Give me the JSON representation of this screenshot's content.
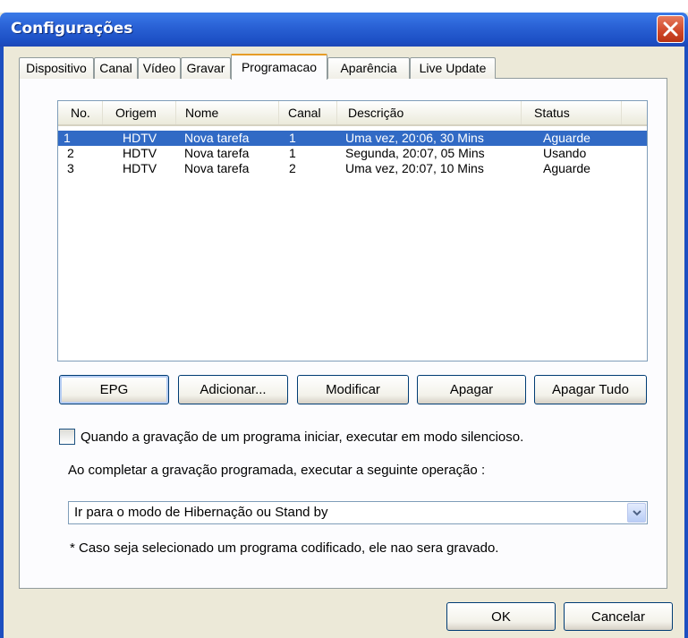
{
  "window": {
    "title": "Configurações"
  },
  "tabs": [
    {
      "label": "Dispositivo"
    },
    {
      "label": "Canal"
    },
    {
      "label": "Vídeo"
    },
    {
      "label": "Gravar"
    },
    {
      "label": "Programacao"
    },
    {
      "label": "Aparência"
    },
    {
      "label": "Live Update"
    }
  ],
  "active_tab": "Programacao",
  "schedule_list": {
    "columns": [
      "No.",
      "Origem",
      "Nome",
      "Canal",
      "Descrição",
      "Status"
    ],
    "rows": [
      {
        "no": "1",
        "origem": "HDTV",
        "nome": "Nova tarefa",
        "canal": "1",
        "descricao": "Uma vez, 20:06, 30 Mins",
        "status": "Aguarde"
      },
      {
        "no": "2",
        "origem": "HDTV",
        "nome": "Nova tarefa",
        "canal": "1",
        "descricao": "Segunda, 20:07, 05 Mins",
        "status": "Usando"
      },
      {
        "no": "3",
        "origem": "HDTV",
        "nome": "Nova tarefa",
        "canal": "2",
        "descricao": "Uma vez, 20:07, 10 Mins",
        "status": "Aguarde"
      }
    ],
    "selected_index": 0
  },
  "buttons": {
    "epg": "EPG",
    "add": "Adicionar...",
    "modify": "Modificar",
    "delete": "Apagar",
    "delete_all": "Apagar Tudo"
  },
  "silent_mode": {
    "label": "Quando a gravação de um programa iniciar, executar em modo silencioso.",
    "checked": false
  },
  "after_recording": {
    "label": "Ao completar a gravação programada, executar a seguinte operação :",
    "selected": "Ir para o modo de Hibernação ou Stand by"
  },
  "note": "* Caso seja selecionado um programa codificado, ele nao sera gravado.",
  "footer": {
    "ok": "OK",
    "cancel": "Cancelar"
  },
  "colors": {
    "titlebar": "#2a62d6",
    "selection": "#316ac5",
    "tab_highlight": "#e69c27",
    "close": "#cf4628"
  }
}
